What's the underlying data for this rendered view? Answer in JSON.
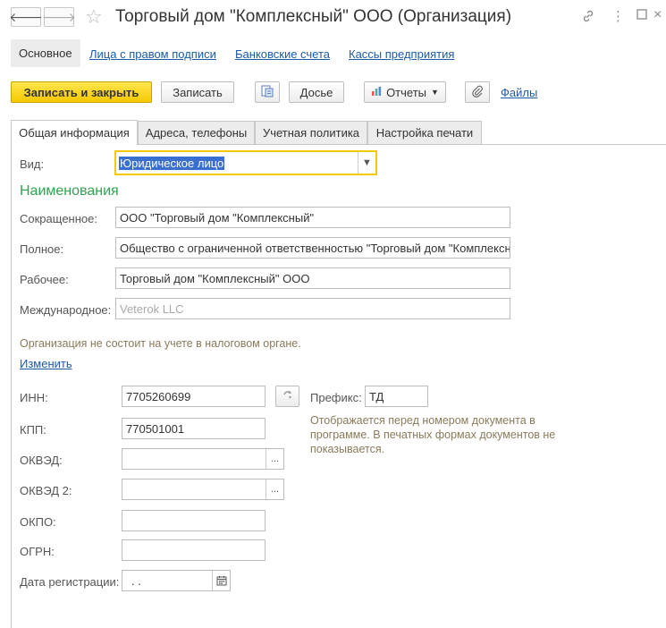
{
  "window": {
    "title": "Торговый дом \"Комплексный\" ООО (Организация)",
    "back_icon": "arrow-left-icon",
    "forward_icon": "arrow-right-icon"
  },
  "sections": [
    {
      "label": "Основное",
      "active": true
    },
    {
      "label": "Лица с правом подписи",
      "active": false
    },
    {
      "label": "Банковские счета",
      "active": false
    },
    {
      "label": "Кассы предприятия",
      "active": false
    }
  ],
  "toolbar": {
    "save_close": "Записать и закрыть",
    "save": "Записать",
    "dossier": "Досье",
    "reports": "Отчеты",
    "files": "Файлы"
  },
  "tabs": [
    {
      "label": "Общая информация",
      "active": true
    },
    {
      "label": "Адреса, телефоны",
      "active": false
    },
    {
      "label": "Учетная политика",
      "active": false
    },
    {
      "label": "Настройка печати",
      "active": false
    }
  ],
  "form": {
    "vid_label": "Вид:",
    "vid_value": "Юридическое лицо",
    "names_header": "Наименования",
    "short_label": "Сокращенное:",
    "short_value": "ООО \"Торговый дом \"Комплексный\"",
    "full_label": "Полное:",
    "full_value": "Общество с ограниченной ответственностью \"Торговый дом \"Комплексный\"",
    "work_label": "Рабочее:",
    "work_value": "Торговый дом \"Комплексный\" ООО",
    "intl_label": "Международное:",
    "intl_placeholder": "Veterok LLC",
    "tax_note": "Организация не состоит на учете в налоговом органе.",
    "change_link": "Изменить",
    "inn_label": "ИНН:",
    "inn_value": "7705260699",
    "kpp_label": "КПП:",
    "kpp_value": "770501001",
    "okved_label": "ОКВЭД:",
    "okved_value": "",
    "okved2_label": "ОКВЭД 2:",
    "okved2_value": "",
    "okpo_label": "ОКПО:",
    "okpo_value": "",
    "ogrn_label": "ОГРН:",
    "ogrn_value": "",
    "regdate_label": "Дата регистрации:",
    "regdate_value": " .  .",
    "prefix_label": "Префикс:",
    "prefix_value": "ТД",
    "prefix_note": "Отображается перед номером документа в программе. В печатных формах документов не показывается."
  },
  "colors": {
    "accent_yellow": "#f5c800",
    "link_blue": "#1a5ba8",
    "group_green": "#2ea44f",
    "note_brown": "#8a7a5a"
  }
}
